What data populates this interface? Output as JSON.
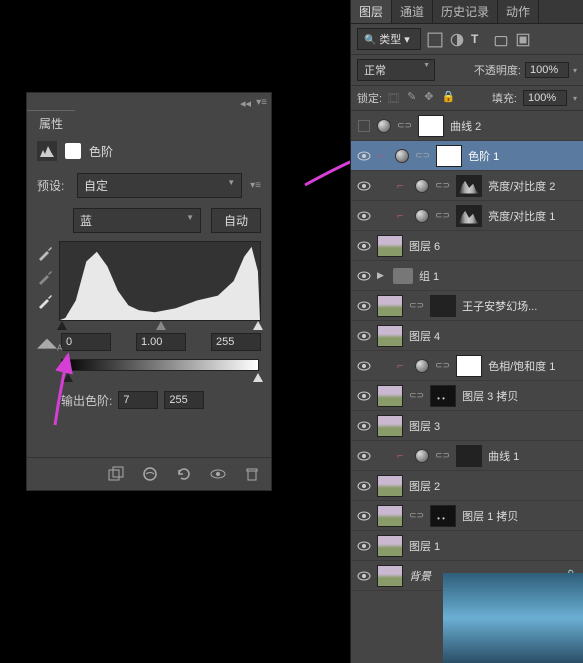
{
  "props": {
    "tab": "属性",
    "title": "色阶",
    "preset_label": "预设:",
    "preset_value": "自定",
    "channel": "蓝",
    "auto_btn": "自动",
    "input_black": "0",
    "input_mid": "1.00",
    "input_white": "255",
    "output_label": "输出色阶:",
    "output_black": "7",
    "output_white": "255"
  },
  "layers_panel": {
    "tabs": [
      "图层",
      "通道",
      "历史记录",
      "动作"
    ],
    "kind": "类型",
    "blend_mode": "正常",
    "opacity_label": "不透明度:",
    "opacity": "100%",
    "lock_label": "锁定:",
    "fill_label": "填充:",
    "fill": "100%"
  },
  "layers": [
    {
      "name": "曲线 2",
      "type": "adj",
      "mask": "white",
      "vis": false
    },
    {
      "name": "色阶 1",
      "type": "adj",
      "mask": "white",
      "vis": true,
      "selected": true,
      "link": true
    },
    {
      "name": "亮度/对比度 2",
      "type": "adj",
      "mask": "hist",
      "vis": true,
      "link": true,
      "indent": true
    },
    {
      "name": "亮度/对比度 1",
      "type": "adj",
      "mask": "hist",
      "vis": true,
      "link": true,
      "indent": true
    },
    {
      "name": "图层 6",
      "type": "img",
      "vis": true
    },
    {
      "name": "组 1",
      "type": "group",
      "vis": true
    },
    {
      "name": "王子安梦幻场...",
      "type": "img-mask",
      "vis": true
    },
    {
      "name": "图层 4",
      "type": "img",
      "vis": true
    },
    {
      "name": "色相/饱和度 1",
      "type": "adj",
      "mask": "white",
      "vis": true,
      "link": true,
      "indent": true
    },
    {
      "name": "图层 3 拷贝",
      "type": "img-dots",
      "vis": true
    },
    {
      "name": "图层 3",
      "type": "img",
      "vis": true
    },
    {
      "name": "曲线 1",
      "type": "adj",
      "mask": "dark",
      "vis": true,
      "link": true,
      "indent": true
    },
    {
      "name": "图层 2",
      "type": "img",
      "vis": true
    },
    {
      "name": "图层 1 拷贝",
      "type": "img-dots",
      "vis": true
    },
    {
      "name": "图层 1",
      "type": "img",
      "vis": true
    },
    {
      "name": "背景",
      "type": "img",
      "vis": true,
      "locked": true,
      "italic": true
    }
  ]
}
